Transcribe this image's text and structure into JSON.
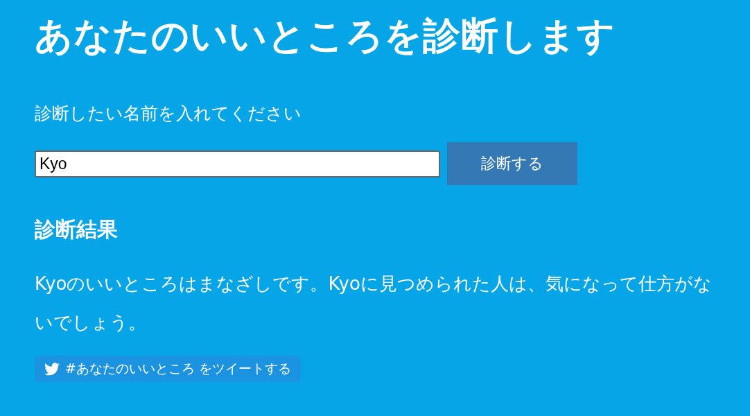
{
  "title": "あなたのいいところを診断します",
  "prompt": "診断したい名前を入れてください",
  "name_field": {
    "value": "Kyo"
  },
  "submit_button": "診断する",
  "result": {
    "heading": "診断結果",
    "text": "Kyoのいいところはまなざしです。Kyoに見つめられた人は、気になって仕方がないでしょう。"
  },
  "tweet_button": "#あなたのいいところ をツイートする"
}
